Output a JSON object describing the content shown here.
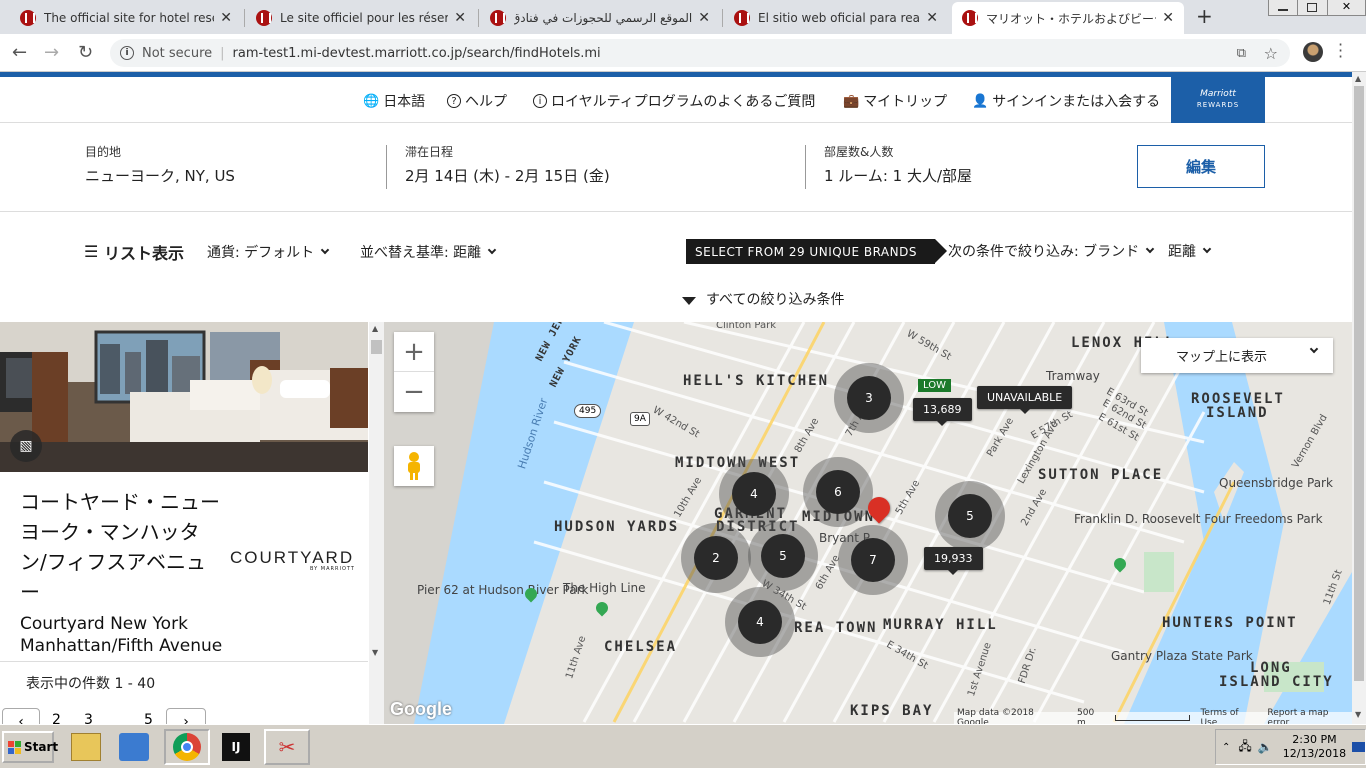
{
  "browser": {
    "tabs": [
      {
        "title": "The official site for hotel reservation",
        "active": false
      },
      {
        "title": "Le site officiel pour les réservations",
        "active": false
      },
      {
        "title": "الموقع الرسمي للحجوزات في فنادق",
        "active": false
      },
      {
        "title": "El sitio web oficial para realizar reser",
        "active": false
      },
      {
        "title": "マリオット・ホテルおよびビーチリゾートのご",
        "active": true
      }
    ],
    "new_tab_label": "+",
    "security_label": "Not secure",
    "url": "ram-test1.mi-devtest.marriott.co.jp/search/findHotels.mi"
  },
  "utility_nav": {
    "language": "日本語",
    "help": "ヘルプ",
    "loyalty_faq": "ロイヤルティプログラムのよくあるご質問",
    "my_trips": "マイトリップ",
    "sign_in": "サインインまたは入会する",
    "rewards_logo_line1": "Marriott",
    "rewards_logo_line2": "REWARDS"
  },
  "search_summary": {
    "destination_label": "目的地",
    "destination_value": "ニューヨーク, NY, US",
    "dates_label": "滞在日程",
    "dates_value": "2月 14日 (木) - 2月 15日 (金)",
    "rooms_label": "部屋数&人数",
    "rooms_value": "1 ルーム: 1 大人/部屋",
    "edit_label": "編集"
  },
  "filters": {
    "list_view": "リスト表示",
    "currency": "通貨: デフォルト",
    "sort": "並べ替え基準: 距離",
    "brands_banner": "SELECT FROM 29 UNIQUE BRANDS",
    "filter_brand": "次の条件で絞り込み: ブランド",
    "distance": "距離",
    "all_filters": "すべての絞り込み条件"
  },
  "hotel_card": {
    "name_ja": "コートヤード・ニューヨーク・マンハッタン/フィフスアベニュー",
    "name_en": "Courtyard New York Manhattan/Fifth Avenue",
    "brand_logo": "COURTYARD",
    "brand_logo_sub": "BY MARRIOTT",
    "results_count": "表示中の件数 1 - 40",
    "pagination": [
      "2",
      "3",
      "5"
    ]
  },
  "map": {
    "zoom_in": "+",
    "zoom_out": "−",
    "show_on_map": "マップ上に表示",
    "neighborhoods": [
      "HELL'S KITCHEN",
      "MIDTOWN WEST",
      "HUDSON YARDS",
      "GARMENT",
      "DISTRICT",
      "MIDTOWN",
      "SUTTON PLACE",
      "ROOSEVELT",
      "ISLAND",
      "LENOX HILL",
      "MURRAY HILL",
      "CHELSEA",
      "KIPS BAY",
      "HUNTERS POINT",
      "LONG",
      "ISLAND CITY",
      "NEW JERSEY",
      "NEW YORK",
      "REA TOWN"
    ],
    "clusters": [
      "3",
      "4",
      "6",
      "5",
      "2",
      "5",
      "7",
      "4"
    ],
    "price_tags": [
      "13,689",
      "19,933"
    ],
    "unavailable_label": "UNAVAILABLE",
    "low_label": "LOW",
    "pois": [
      "Pier 62 at Hudson River Park",
      "The High Line",
      "Queensbridge Park",
      "Franklin D. Roosevelt Four Freedoms Park",
      "Gantry Plaza State Park",
      "Tramway",
      "Bryant P"
    ],
    "streets": [
      "W 59th St",
      "W 42nd St",
      "Hudson River",
      "10th Ave",
      "8th Ave",
      "7th Ave",
      "6th Ave",
      "5th Ave",
      "Park Ave",
      "Lexington Ave",
      "2nd Ave",
      "E 57th St",
      "E 63rd St",
      "E 62nd St",
      "E 61st St",
      "Vernon Blvd",
      "11th St",
      "W 34th St",
      "E 34th St",
      "11th Ave",
      "1st Avenue",
      "FDR Dr.",
      "Clinton Park",
      "9A",
      "495"
    ],
    "attribution_google": "Google",
    "map_data": "Map data ©2018 Google",
    "scale": "500 m",
    "terms": "Terms of Use",
    "report": "Report a map error"
  },
  "taskbar": {
    "start": "Start",
    "time": "2:30 PM",
    "date": "12/13/2018"
  }
}
